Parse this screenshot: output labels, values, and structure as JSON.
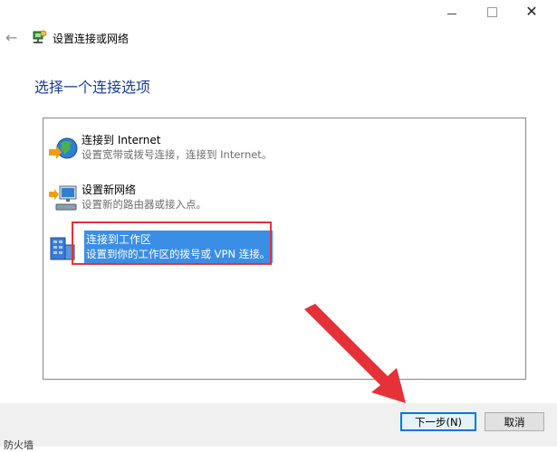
{
  "window": {
    "controls": {
      "minimize": "minimize",
      "maximize": "maximize",
      "close": "close"
    },
    "header_title": "设置连接或网络"
  },
  "page": {
    "heading": "选择一个连接选项"
  },
  "options": [
    {
      "title": "连接到 Internet",
      "description": "设置宽带或拨号连接，连接到 Internet。",
      "icon": "internet-globe-icon"
    },
    {
      "title": "设置新网络",
      "description": "设置新的路由器或接入点。",
      "icon": "new-network-icon"
    },
    {
      "title": "连接到工作区",
      "description": "设置到你的工作区的拨号或 VPN 连接。",
      "icon": "workplace-icon",
      "selected": true
    }
  ],
  "buttons": {
    "next": "下一步(N)",
    "cancel": "取消"
  },
  "bottom_peek_text": "防火墙",
  "colors": {
    "heading": "#1a3c9a",
    "selection": "#3a8ee6",
    "annotation_red": "#e53238",
    "focus_border": "#0078d7"
  }
}
